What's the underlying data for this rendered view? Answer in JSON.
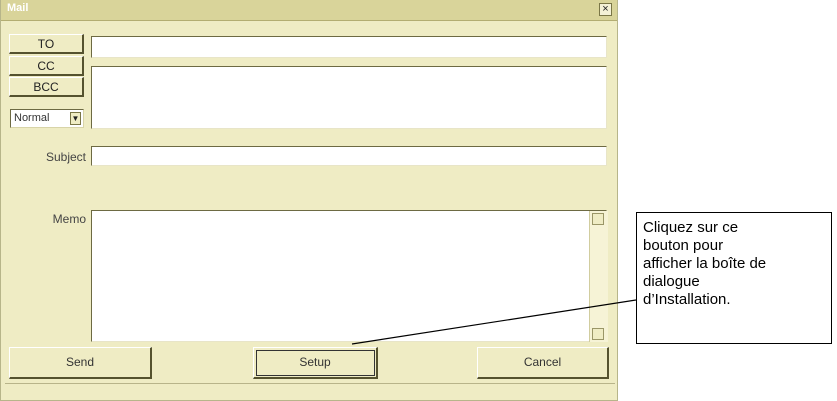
{
  "window": {
    "title": "Mail",
    "close_symbol": "×"
  },
  "recipients": {
    "to_label": "TO",
    "cc_label": "CC",
    "bcc_label": "BCC",
    "to_value": "",
    "cc_value": ""
  },
  "priority_select": {
    "selected": "Normal",
    "arrow_symbol": "▼"
  },
  "subject": {
    "label": "Subject",
    "value": ""
  },
  "memo": {
    "label": "Memo",
    "value": ""
  },
  "buttons": {
    "send": "Send",
    "setup": "Setup",
    "cancel": "Cancel"
  },
  "callout": {
    "line1": "Cliquez sur ce",
    "line2": "bouton pour",
    "line3": "afficher la boîte de",
    "line4": "dialogue",
    "line5": "d’Installation."
  }
}
